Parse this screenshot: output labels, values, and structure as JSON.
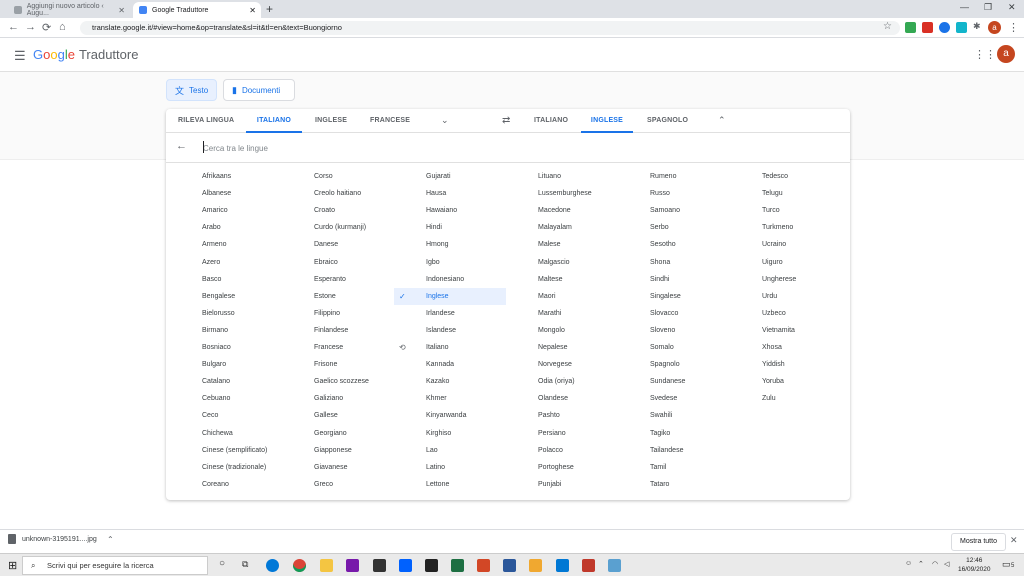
{
  "browser": {
    "tabs": [
      {
        "title": "Aggiungi nuovo articolo ‹ Augu...",
        "active": false
      },
      {
        "title": "Google Traduttore",
        "active": true
      }
    ],
    "url": "translate.google.it/#view=home&op=translate&sl=it&tl=en&text=Buongiorno",
    "profile_initial": "a"
  },
  "header": {
    "logo": "Google",
    "product": "Traduttore",
    "avatar_initial": "a"
  },
  "modes": {
    "text_label": "Testo",
    "docs_label": "Documenti"
  },
  "source_langs": [
    "RILEVA LINGUA",
    "ITALIANO",
    "INGLESE",
    "FRANCESE"
  ],
  "source_active": "ITALIANO",
  "target_langs": [
    "ITALIANO",
    "INGLESE",
    "SPAGNOLO"
  ],
  "target_active": "INGLESE",
  "search": {
    "placeholder": "Cerca tra le lingue",
    "value": ""
  },
  "selected_language": "Inglese",
  "recent_language": "Italiano",
  "languages": [
    [
      "Afrikaans",
      "Albanese",
      "Amarico",
      "Arabo",
      "Armeno",
      "Azero",
      "Basco",
      "Bengalese",
      "Bielorusso",
      "Birmano",
      "Bosniaco",
      "Bulgaro",
      "Catalano",
      "Cebuano",
      "Ceco",
      "Chichewa",
      "Cinese (semplificato)",
      "Cinese (tradizionale)",
      "Coreano"
    ],
    [
      "Corso",
      "Creolo haitiano",
      "Croato",
      "Curdo (kurmanji)",
      "Danese",
      "Ebraico",
      "Esperanto",
      "Estone",
      "Filippino",
      "Finlandese",
      "Francese",
      "Frisone",
      "Gaelico scozzese",
      "Galiziano",
      "Gallese",
      "Georgiano",
      "Giapponese",
      "Giavanese",
      "Greco"
    ],
    [
      "Gujarati",
      "Hausa",
      "Hawaiano",
      "Hindi",
      "Hmong",
      "Igbo",
      "Indonesiano",
      "Inglese",
      "Irlandese",
      "Islandese",
      "Italiano",
      "Kannada",
      "Kazako",
      "Khmer",
      "Kinyarwanda",
      "Kirghiso",
      "Lao",
      "Latino",
      "Lettone"
    ],
    [
      "Lituano",
      "Lussemburghese",
      "Macedone",
      "Malayalam",
      "Malese",
      "Malgascio",
      "Maltese",
      "Maori",
      "Marathi",
      "Mongolo",
      "Nepalese",
      "Norvegese",
      "Odia (oriya)",
      "Olandese",
      "Pashto",
      "Persiano",
      "Polacco",
      "Portoghese",
      "Punjabi"
    ],
    [
      "Rumeno",
      "Russo",
      "Samoano",
      "Serbo",
      "Sesotho",
      "Shona",
      "Sindhi",
      "Singalese",
      "Slovacco",
      "Sloveno",
      "Somalo",
      "Spagnolo",
      "Sundanese",
      "Svedese",
      "Swahili",
      "Tagiko",
      "Tailandese",
      "Tamil",
      "Tataro"
    ],
    [
      "Tedesco",
      "Telugu",
      "Turco",
      "Turkmeno",
      "Ucraino",
      "Uiguro",
      "Ungherese",
      "Urdu",
      "Uzbeco",
      "Vietnamita",
      "Xhosa",
      "Yiddish",
      "Yoruba",
      "Zulu"
    ]
  ],
  "download": {
    "file": "unknown-3195191....jpg",
    "show_all": "Mostra tutto"
  },
  "taskbar": {
    "search_placeholder": "Scrivi qui per eseguire la ricerca",
    "time": "12:46",
    "date": "16/09/2020",
    "notif_count": "5"
  },
  "colors": {
    "accent": "#1a73e8",
    "selected_bg": "#e8f0fe"
  }
}
